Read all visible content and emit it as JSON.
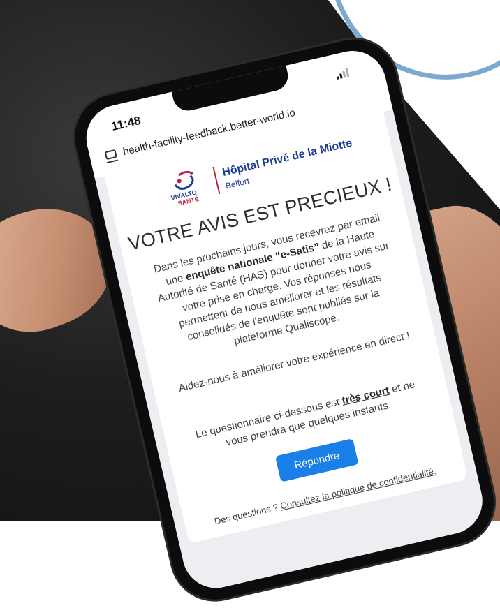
{
  "status_bar": {
    "time": "11:48"
  },
  "browser": {
    "url": "health-facility-feedback.better-world.io"
  },
  "hospital": {
    "logo_text_1": "VIVALTO",
    "logo_text_2": "SANTÉ",
    "name": "Hôpital Privé de la Miotte",
    "city": "Belfort",
    "brand_colors": {
      "blue": "#1c3d8f",
      "red": "#c21d46"
    }
  },
  "survey": {
    "headline": "VOTRE AVIS EST PRECIEUX !",
    "intro_1": "Dans les prochains jours, vous recevrez par email une ",
    "intro_bold_1": "enquête nationale “e-Satis”",
    "intro_2": " de la Haute Autorité de Santé (HAS) pour donner votre avis sur votre prise en charge. Vos réponses nous permettent de nous améliorer et les résultats consolidés de l'enquête sont publiés sur la plateforme Qualiscope.",
    "help_text": "Aidez-nous à améliorer votre expérience en direct !",
    "short_1": "Le questionnaire ci-dessous est ",
    "short_bold": "très court",
    "short_2": " et ne vous prendra que quelques instants.",
    "respond_button": "Répondre",
    "button_color": "#1a7fe8",
    "footer_prefix": "Des questions ? ",
    "privacy_link": "Consultez la politique de confidentialité."
  }
}
